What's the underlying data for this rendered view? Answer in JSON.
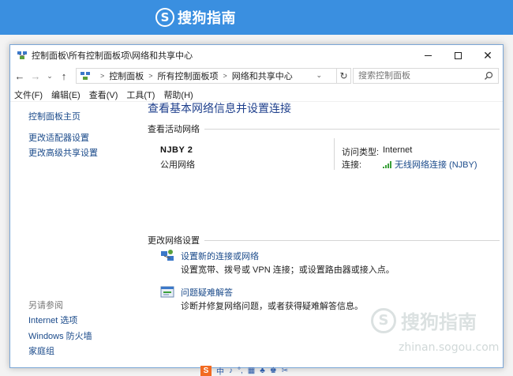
{
  "banner": {
    "brand_logo": "S",
    "brand_text": "搜狗指南"
  },
  "window": {
    "title": "控制面板\\所有控制面板项\\网络和共享中心",
    "controls": {
      "close": "✕"
    }
  },
  "address": {
    "breadcrumbs": [
      "控制面板",
      "所有控制面板项",
      "网络和共享中心"
    ],
    "search_placeholder": "搜索控制面板"
  },
  "menu": [
    "文件(F)",
    "编辑(E)",
    "查看(V)",
    "工具(T)",
    "帮助(H)"
  ],
  "left_pane": {
    "home": "控制面板主页",
    "links": [
      "更改适配器设置",
      "更改高级共享设置"
    ],
    "see_also_label": "另请参阅",
    "see_also": [
      "Internet 选项",
      "Windows 防火墙",
      "家庭组"
    ]
  },
  "main": {
    "title": "查看基本网络信息并设置连接",
    "active_section": "查看活动网络",
    "network": {
      "name": "NJBY  2",
      "type": "公用网络",
      "access_label": "访问类型:",
      "access_value": "Internet",
      "connection_label": "连接:",
      "connection_value": "无线网络连接 (NJBY)"
    },
    "change_section": "更改网络设置",
    "tasks": [
      {
        "link": "设置新的连接或网络",
        "desc": "设置宽带、拨号或 VPN 连接；或设置路由器或接入点。"
      },
      {
        "link": "问题疑难解答",
        "desc": "诊断并修复网络问题，或者获得疑难解答信息。"
      }
    ]
  },
  "watermark": {
    "logo": "S",
    "text": "搜狗指南",
    "url": "zhinan.sogou.com"
  },
  "ime": {
    "logo": "S",
    "items": [
      "中",
      "♪",
      "°,",
      "▦",
      "♣",
      "♚",
      "✂"
    ]
  }
}
